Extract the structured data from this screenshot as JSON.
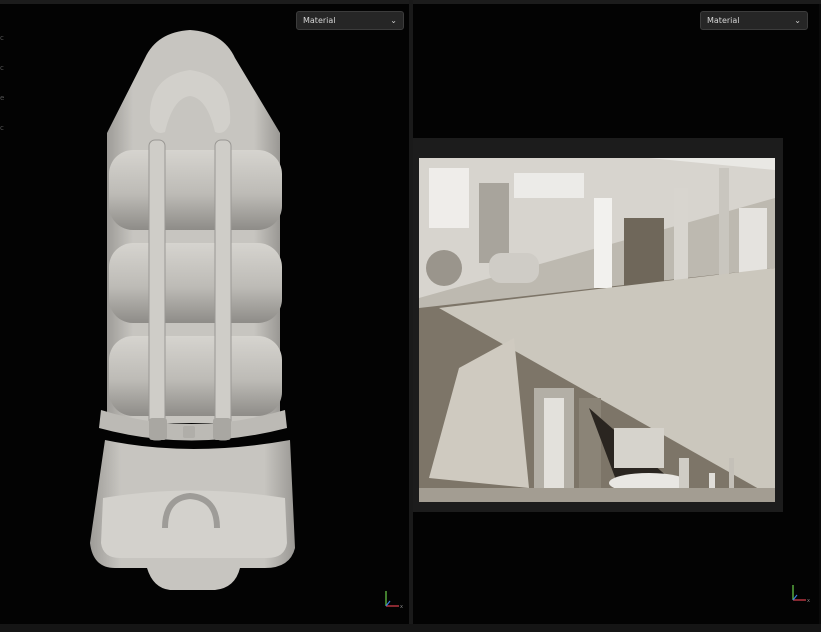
{
  "viewports": {
    "left": {
      "shading_mode": "Material",
      "view_name": "3d-model-view"
    },
    "right": {
      "shading_mode": "Material",
      "view_name": "texture-bake-view"
    }
  },
  "gizmo": {
    "axis_x_label": "x",
    "axis_y_label": "y"
  },
  "colors": {
    "background": "#030303",
    "model": "#c9c7c2",
    "dropdown_bg": "#262626",
    "axis_x": "#e0414f",
    "axis_y": "#6bcf4a",
    "axis_z": "#3b7ae0"
  }
}
